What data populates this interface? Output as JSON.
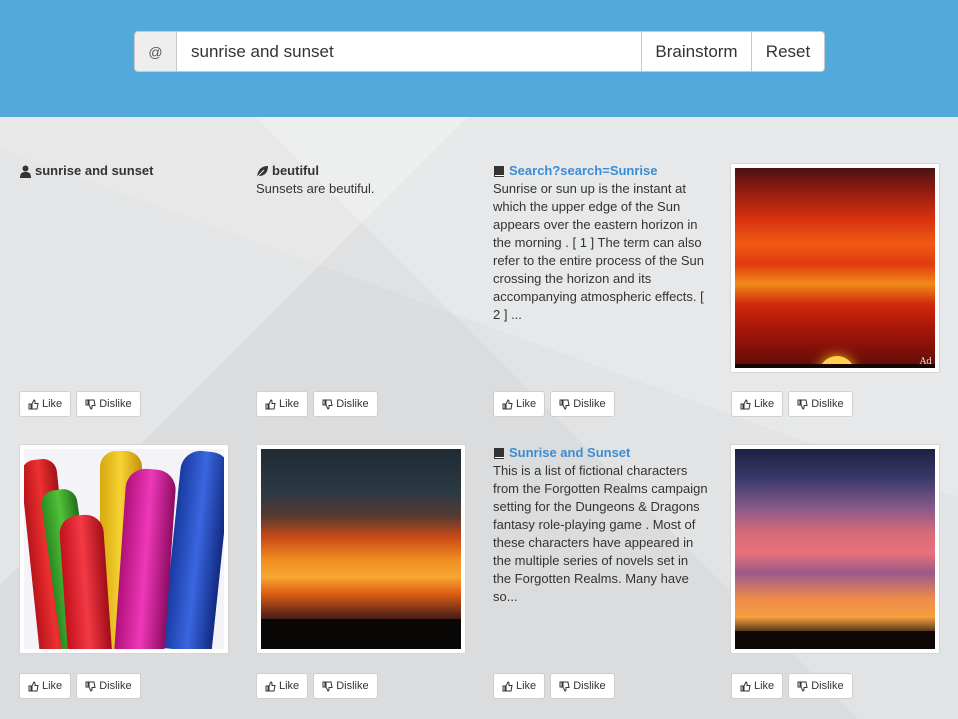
{
  "search": {
    "at_symbol": "@",
    "value": "sunrise and sunset",
    "brainstorm_label": "Brainstorm",
    "reset_label": "Reset"
  },
  "vote": {
    "like": "Like",
    "dislike": "Dislike"
  },
  "cards": [
    {
      "icon": "user-icon",
      "title": "sunrise and sunset",
      "body": ""
    },
    {
      "icon": "leaf-icon",
      "title": "beutiful",
      "body": "Sunsets are beutiful."
    },
    {
      "icon": "book-icon",
      "title": "Search?search=Sunrise",
      "body": "Sunrise or sun up is the instant at which the upper edge of the Sun appears over the eastern horizon in the morning . [ 1 ] The term can also refer to the entire process of the Sun crossing the horizon and its accompanying atmospheric effects. [ 2 ] ..."
    },
    {
      "icon": "image",
      "title": "",
      "body": "",
      "watermark": "Ad"
    },
    {
      "icon": "image",
      "title": "",
      "body": ""
    },
    {
      "icon": "image",
      "title": "",
      "body": ""
    },
    {
      "icon": "book-icon",
      "title": "Sunrise and Sunset",
      "body": "This is a list of fictional characters from the Forgotten Realms campaign setting for the Dungeons & Dragons fantasy role-playing game . Most of these characters have appeared in the multiple series of novels set in the Forgotten Realms. Many have so..."
    },
    {
      "icon": "image",
      "title": "",
      "body": ""
    }
  ]
}
